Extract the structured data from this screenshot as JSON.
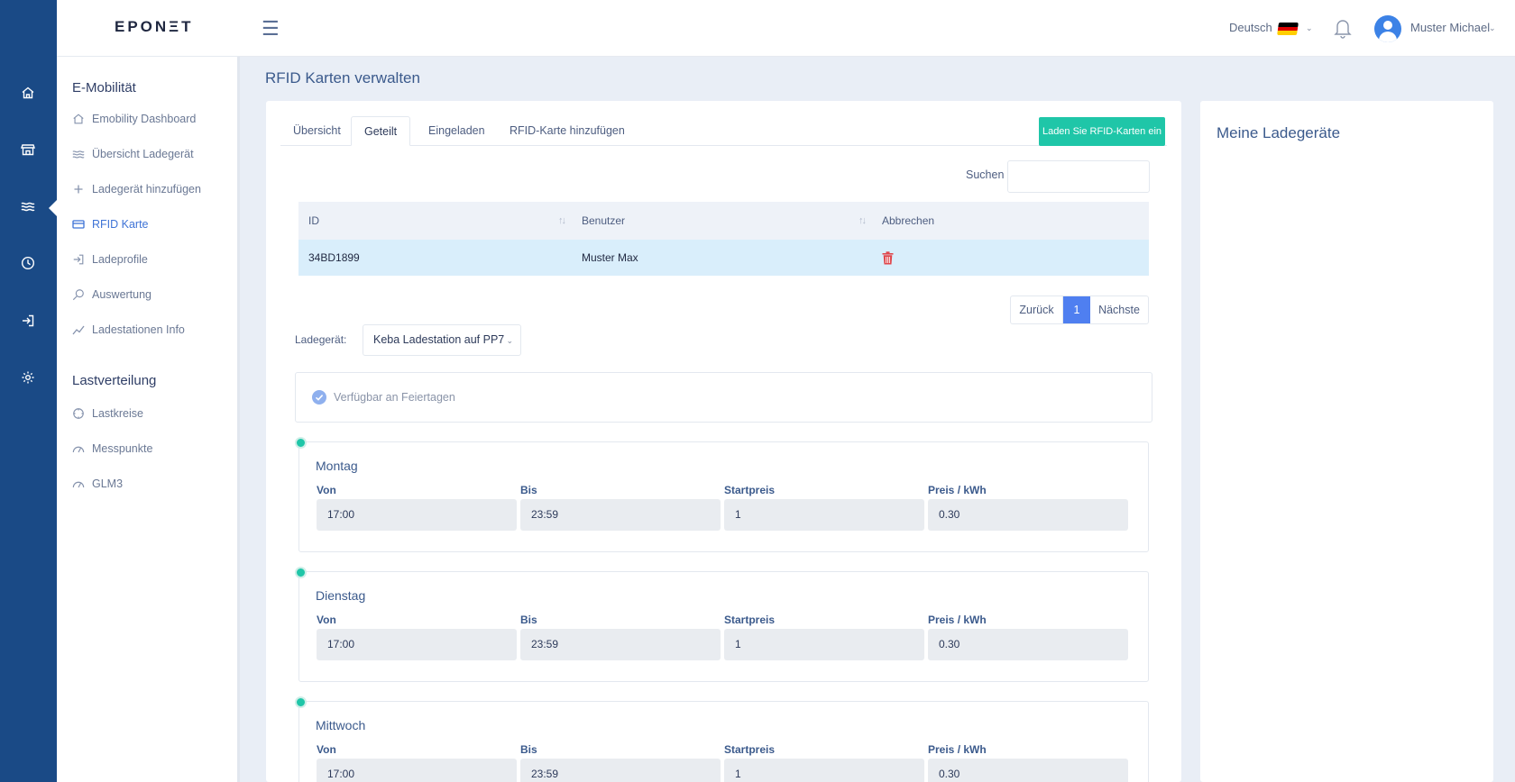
{
  "app": {
    "logo": "EPONΞT"
  },
  "header": {
    "language": "Deutsch",
    "user": "Muster Michael",
    "flag_colors": [
      "#000000",
      "#dd0000",
      "#ffce00"
    ]
  },
  "rail": {
    "icons": [
      "home-icon",
      "store-icon",
      "waves-icon",
      "clock-icon",
      "login-icon",
      "gear-icon"
    ]
  },
  "sidebar": {
    "section1": "E-Mobilität",
    "items1": [
      {
        "label": "Emobility Dashboard",
        "icon": "home-icon"
      },
      {
        "label": "Übersicht Ladegerät",
        "icon": "waves-icon"
      },
      {
        "label": "Ladegerät hinzufügen",
        "icon": "plus-icon"
      },
      {
        "label": "RFID Karte",
        "icon": "card-icon",
        "active": true
      },
      {
        "label": "Ladeprofile",
        "icon": "login-icon"
      },
      {
        "label": "Auswertung",
        "icon": "search-icon"
      },
      {
        "label": "Ladestationen Info",
        "icon": "chart-line-icon"
      }
    ],
    "section2": "Lastverteilung",
    "items2": [
      {
        "label": "Lastkreise",
        "icon": "circle-icon"
      },
      {
        "label": "Messpunkte",
        "icon": "gauge-icon"
      },
      {
        "label": "GLM3",
        "icon": "gauge-icon"
      }
    ]
  },
  "page": {
    "title": "RFID Karten verwalten"
  },
  "tabs": [
    {
      "label": "Übersicht"
    },
    {
      "label": "Geteilt",
      "active": true
    },
    {
      "label": "Eingeladen"
    },
    {
      "label": "RFID-Karte hinzufügen"
    }
  ],
  "load_button": "Laden Sie RFID-Karten ein",
  "search": {
    "label": "Suchen",
    "value": "",
    "placeholder": ""
  },
  "table": {
    "headers": [
      "ID",
      "Benutzer",
      "Abbrechen"
    ],
    "rows": [
      {
        "id": "34BD1899",
        "user": "Muster Max"
      }
    ]
  },
  "pagination": {
    "prev": "Zurück",
    "current": "1",
    "next": "Nächste"
  },
  "charger": {
    "label": "Ladegerät:",
    "selected": "Keba Ladestation auf PP7"
  },
  "holiday": {
    "label": "Verfügbar an Feiertagen",
    "checked": true
  },
  "fields": {
    "from": "Von",
    "to": "Bis",
    "start_price": "Startpreis",
    "price_kwh": "Preis / kWh"
  },
  "days": [
    {
      "name": "Montag",
      "from": "17:00",
      "to": "23:59",
      "start_price": "1",
      "price_kwh": "0.30"
    },
    {
      "name": "Dienstag",
      "from": "17:00",
      "to": "23:59",
      "start_price": "1",
      "price_kwh": "0.30"
    },
    {
      "name": "Mittwoch",
      "from": "17:00",
      "to": "23:59",
      "start_price": "1",
      "price_kwh": "0.30"
    }
  ],
  "side": {
    "title": "Meine Ladegeräte"
  },
  "colors": {
    "rail": "#1a4a86",
    "accent": "#1fc6a8",
    "active": "#3e73d6",
    "page_btn": "#4f7ff0",
    "delete": "#e0474c"
  }
}
